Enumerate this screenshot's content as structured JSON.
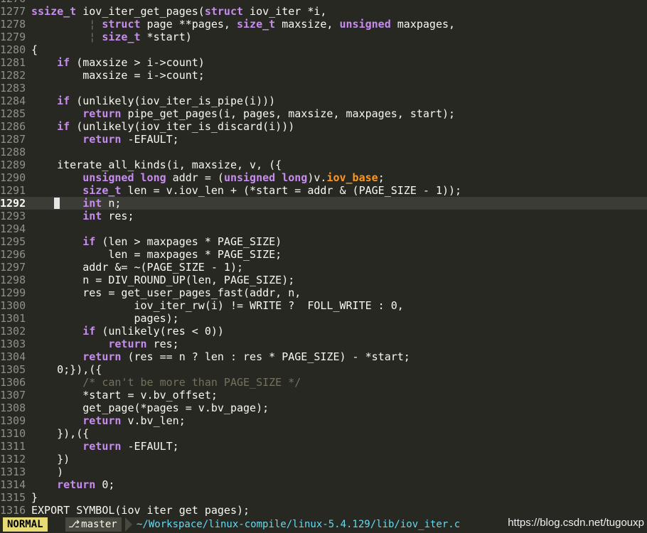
{
  "editor": {
    "mode": "NORMAL",
    "branch": "master",
    "file_path": "~/Workspace/linux-compile/linux-5.4.129/lib/iov_iter.c",
    "watermark": "https://blog.csdn.net/tugouxp",
    "current_line": "1292",
    "lines": [
      {
        "n": "1276",
        "seg": []
      },
      {
        "n": "1277",
        "seg": [
          {
            "t": "ty",
            "v": "ssize_t"
          },
          {
            "t": "",
            "v": " iov_iter_get_pages("
          },
          {
            "t": "kw",
            "v": "struct"
          },
          {
            "t": "",
            "v": " iov_iter *i,"
          }
        ]
      },
      {
        "n": "1278",
        "seg": [
          {
            "t": "cm",
            "v": "         ¦ "
          },
          {
            "t": "kw",
            "v": "struct"
          },
          {
            "t": "",
            "v": " page **pages, "
          },
          {
            "t": "ty",
            "v": "size_t"
          },
          {
            "t": "",
            "v": " maxsize, "
          },
          {
            "t": "kw",
            "v": "unsigned"
          },
          {
            "t": "",
            "v": " maxpages,"
          }
        ]
      },
      {
        "n": "1279",
        "seg": [
          {
            "t": "cm",
            "v": "         ¦ "
          },
          {
            "t": "ty",
            "v": "size_t"
          },
          {
            "t": "",
            "v": " *start)"
          }
        ]
      },
      {
        "n": "1280",
        "seg": [
          {
            "t": "",
            "v": "{"
          }
        ]
      },
      {
        "n": "1281",
        "seg": [
          {
            "t": "",
            "v": "    "
          },
          {
            "t": "kw",
            "v": "if"
          },
          {
            "t": "",
            "v": " (maxsize > i->count)"
          }
        ]
      },
      {
        "n": "1282",
        "seg": [
          {
            "t": "",
            "v": "        maxsize = i->count;"
          }
        ]
      },
      {
        "n": "1283",
        "seg": []
      },
      {
        "n": "1284",
        "seg": [
          {
            "t": "",
            "v": "    "
          },
          {
            "t": "kw",
            "v": "if"
          },
          {
            "t": "",
            "v": " (unlikely(iov_iter_is_pipe(i)))"
          }
        ]
      },
      {
        "n": "1285",
        "seg": [
          {
            "t": "",
            "v": "        "
          },
          {
            "t": "kw",
            "v": "return"
          },
          {
            "t": "",
            "v": " pipe_get_pages(i, pages, maxsize, maxpages, start);"
          }
        ]
      },
      {
        "n": "1286",
        "seg": [
          {
            "t": "",
            "v": "    "
          },
          {
            "t": "kw",
            "v": "if"
          },
          {
            "t": "",
            "v": " (unlikely(iov_iter_is_discard(i)))"
          }
        ]
      },
      {
        "n": "1287",
        "seg": [
          {
            "t": "",
            "v": "        "
          },
          {
            "t": "kw",
            "v": "return"
          },
          {
            "t": "",
            "v": " -EFAULT;"
          }
        ]
      },
      {
        "n": "1288",
        "seg": []
      },
      {
        "n": "1289",
        "seg": [
          {
            "t": "",
            "v": "    iterate_all_kinds(i, maxsize, v, ({"
          }
        ]
      },
      {
        "n": "1290",
        "seg": [
          {
            "t": "",
            "v": "        "
          },
          {
            "t": "kw",
            "v": "unsigned"
          },
          {
            "t": "",
            "v": " "
          },
          {
            "t": "kw",
            "v": "long"
          },
          {
            "t": "",
            "v": " addr = ("
          },
          {
            "t": "kw",
            "v": "unsigned"
          },
          {
            "t": "",
            "v": " "
          },
          {
            "t": "kw",
            "v": "long"
          },
          {
            "t": "",
            "v": ")v."
          },
          {
            "t": "fl",
            "v": "iov_base"
          },
          {
            "t": "",
            "v": ";"
          }
        ]
      },
      {
        "n": "1291",
        "seg": [
          {
            "t": "",
            "v": "        "
          },
          {
            "t": "ty",
            "v": "size_t"
          },
          {
            "t": "",
            "v": " len = v.iov_len + (*start = addr & (PAGE_SIZE - 1));"
          }
        ]
      },
      {
        "n": "1292",
        "seg": [
          {
            "t": "",
            "v": "        "
          },
          {
            "t": "ty",
            "v": "int"
          },
          {
            "t": "",
            "v": " n;"
          }
        ]
      },
      {
        "n": "1293",
        "seg": [
          {
            "t": "",
            "v": "        "
          },
          {
            "t": "ty",
            "v": "int"
          },
          {
            "t": "",
            "v": " res;"
          }
        ]
      },
      {
        "n": "1294",
        "seg": []
      },
      {
        "n": "1295",
        "seg": [
          {
            "t": "",
            "v": "        "
          },
          {
            "t": "kw",
            "v": "if"
          },
          {
            "t": "",
            "v": " (len > maxpages * PAGE_SIZE)"
          }
        ]
      },
      {
        "n": "1296",
        "seg": [
          {
            "t": "",
            "v": "            len = maxpages * PAGE_SIZE;"
          }
        ]
      },
      {
        "n": "1297",
        "seg": [
          {
            "t": "",
            "v": "        addr &= ~(PAGE_SIZE - 1);"
          }
        ]
      },
      {
        "n": "1298",
        "seg": [
          {
            "t": "",
            "v": "        n = DIV_ROUND_UP(len, PAGE_SIZE);"
          }
        ]
      },
      {
        "n": "1299",
        "seg": [
          {
            "t": "",
            "v": "        res = get_user_pages_fast(addr, n,"
          }
        ]
      },
      {
        "n": "1300",
        "seg": [
          {
            "t": "",
            "v": "                iov_iter_rw(i) != WRITE ?  FOLL_WRITE : 0,"
          }
        ]
      },
      {
        "n": "1301",
        "seg": [
          {
            "t": "",
            "v": "                pages);"
          }
        ]
      },
      {
        "n": "1302",
        "seg": [
          {
            "t": "",
            "v": "        "
          },
          {
            "t": "kw",
            "v": "if"
          },
          {
            "t": "",
            "v": " (unlikely(res < 0))"
          }
        ]
      },
      {
        "n": "1303",
        "seg": [
          {
            "t": "",
            "v": "            "
          },
          {
            "t": "kw",
            "v": "return"
          },
          {
            "t": "",
            "v": " res;"
          }
        ]
      },
      {
        "n": "1304",
        "seg": [
          {
            "t": "",
            "v": "        "
          },
          {
            "t": "kw",
            "v": "return"
          },
          {
            "t": "",
            "v": " (res == n ? len : res * PAGE_SIZE) - *start;"
          }
        ]
      },
      {
        "n": "1305",
        "seg": [
          {
            "t": "",
            "v": "    0;}),({"
          }
        ]
      },
      {
        "n": "1306",
        "seg": [
          {
            "t": "",
            "v": "        "
          },
          {
            "t": "cm",
            "v": "/* can't be more than PAGE_SIZE */"
          }
        ]
      },
      {
        "n": "1307",
        "seg": [
          {
            "t": "",
            "v": "        *start = v.bv_offset;"
          }
        ]
      },
      {
        "n": "1308",
        "seg": [
          {
            "t": "",
            "v": "        get_page(*pages = v.bv_page);"
          }
        ]
      },
      {
        "n": "1309",
        "seg": [
          {
            "t": "",
            "v": "        "
          },
          {
            "t": "kw",
            "v": "return"
          },
          {
            "t": "",
            "v": " v.bv_len;"
          }
        ]
      },
      {
        "n": "1310",
        "seg": [
          {
            "t": "",
            "v": "    }),({"
          }
        ]
      },
      {
        "n": "1311",
        "seg": [
          {
            "t": "",
            "v": "        "
          },
          {
            "t": "kw",
            "v": "return"
          },
          {
            "t": "",
            "v": " -EFAULT;"
          }
        ]
      },
      {
        "n": "1312",
        "seg": [
          {
            "t": "",
            "v": "    })"
          }
        ]
      },
      {
        "n": "1313",
        "seg": [
          {
            "t": "",
            "v": "    )"
          }
        ]
      },
      {
        "n": "1314",
        "seg": [
          {
            "t": "",
            "v": "    "
          },
          {
            "t": "kw",
            "v": "return"
          },
          {
            "t": "",
            "v": " 0;"
          }
        ]
      },
      {
        "n": "1315",
        "seg": [
          {
            "t": "",
            "v": "}"
          }
        ]
      },
      {
        "n": "1316",
        "seg": [
          {
            "t": "",
            "v": "EXPORT_SYMBOL(iov_iter_get_pages);"
          }
        ]
      }
    ]
  }
}
